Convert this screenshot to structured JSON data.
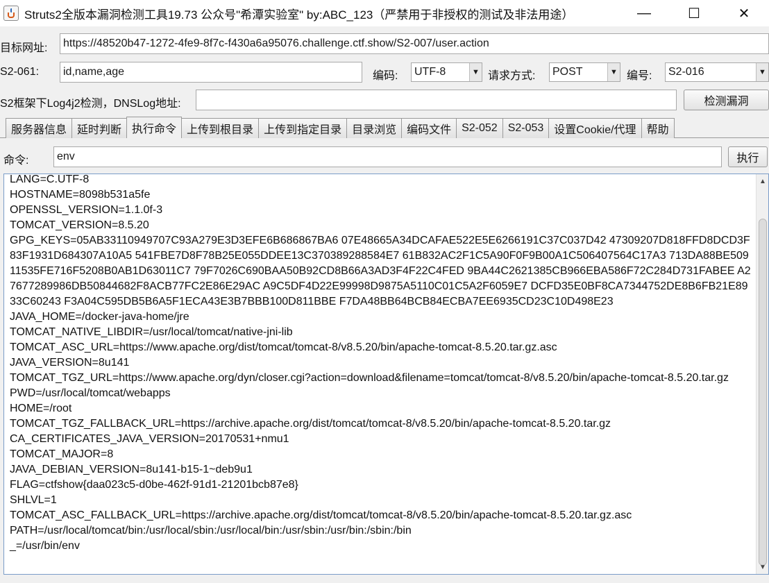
{
  "window": {
    "title": "Struts2全版本漏洞检测工具19.73 公众号\"希潭实验室\" by:ABC_123（严禁用于非授权的测试及非法用途）",
    "minimize": "—",
    "maximize": "☐",
    "close": "✕"
  },
  "target": {
    "label": "目标网址:",
    "value": "https://48520b47-1272-4fe9-8f7c-f430a6a95076.challenge.ctf.show/S2-007/user.action"
  },
  "s2061": {
    "label": "S2-061:",
    "value": "id,name,age"
  },
  "encoding": {
    "label": "编码:",
    "value": "UTF-8"
  },
  "method": {
    "label": "请求方式:",
    "value": "POST"
  },
  "number": {
    "label": "编号:",
    "value": "S2-016"
  },
  "log4j": {
    "label": "S2框架下Log4j2检测，DNSLog地址:",
    "value": "",
    "button": "检测漏洞"
  },
  "tabs": [
    {
      "label": "服务器信息"
    },
    {
      "label": "延时判断"
    },
    {
      "label": "执行命令"
    },
    {
      "label": "上传到根目录"
    },
    {
      "label": "上传到指定目录"
    },
    {
      "label": "目录浏览"
    },
    {
      "label": "编码文件"
    },
    {
      "label": "S2-052"
    },
    {
      "label": "S2-053"
    },
    {
      "label": "设置Cookie/代理"
    },
    {
      "label": "帮助"
    }
  ],
  "command": {
    "label": "命令:",
    "value": "env",
    "button": "执行"
  },
  "output": "LANG=C.UTF-8\nHOSTNAME=8098b531a5fe\nOPENSSL_VERSION=1.1.0f-3\nTOMCAT_VERSION=8.5.20\nGPG_KEYS=05AB33110949707C93A279E3D3EFE6B686867BA6 07E48665A34DCAFAE522E5E6266191C37C037D42 47309207D818FFD8DCD3F83F1931D684307A10A5 541FBE7D8F78B25E055DDEE13C370389288584E7 61B832AC2F1C5A90F0F9B00A1C506407564C17A3 713DA88BE50911535FE716F5208B0AB1D63011C7 79F7026C690BAA50B92CD8B66A3AD3F4F22C4FED 9BA44C2621385CB966EBA586F72C284D731FABEE A27677289986DB50844682F8ACB77FC2E86E29AC A9C5DF4D22E99998D9875A5110C01C5A2F6059E7 DCFD35E0BF8CA7344752DE8B6FB21E8933C60243 F3A04C595DB5B6A5F1ECA43E3B7BBB100D811BBE F7DA48BB64BCB84ECBA7EE6935CD23C10D498E23\nJAVA_HOME=/docker-java-home/jre\nTOMCAT_NATIVE_LIBDIR=/usr/local/tomcat/native-jni-lib\nTOMCAT_ASC_URL=https://www.apache.org/dist/tomcat/tomcat-8/v8.5.20/bin/apache-tomcat-8.5.20.tar.gz.asc\nJAVA_VERSION=8u141\nTOMCAT_TGZ_URL=https://www.apache.org/dyn/closer.cgi?action=download&filename=tomcat/tomcat-8/v8.5.20/bin/apache-tomcat-8.5.20.tar.gz\nPWD=/usr/local/tomcat/webapps\nHOME=/root\nTOMCAT_TGZ_FALLBACK_URL=https://archive.apache.org/dist/tomcat/tomcat-8/v8.5.20/bin/apache-tomcat-8.5.20.tar.gz\nCA_CERTIFICATES_JAVA_VERSION=20170531+nmu1\nTOMCAT_MAJOR=8\nJAVA_DEBIAN_VERSION=8u141-b15-1~deb9u1\nFLAG=ctfshow{daa023c5-d0be-462f-91d1-21201bcb87e8}\nSHLVL=1\nTOMCAT_ASC_FALLBACK_URL=https://archive.apache.org/dist/tomcat/tomcat-8/v8.5.20/bin/apache-tomcat-8.5.20.tar.gz.asc\nPATH=/usr/local/tomcat/bin:/usr/local/sbin:/usr/local/bin:/usr/sbin:/usr/bin:/sbin:/bin\n_=/usr/bin/env",
  "icons": {
    "app": "java-cup-icon",
    "dropdown": "chevron-down-icon",
    "scroll_up": "scroll-up-arrow-icon",
    "scroll_down": "scroll-down-arrow-icon"
  }
}
